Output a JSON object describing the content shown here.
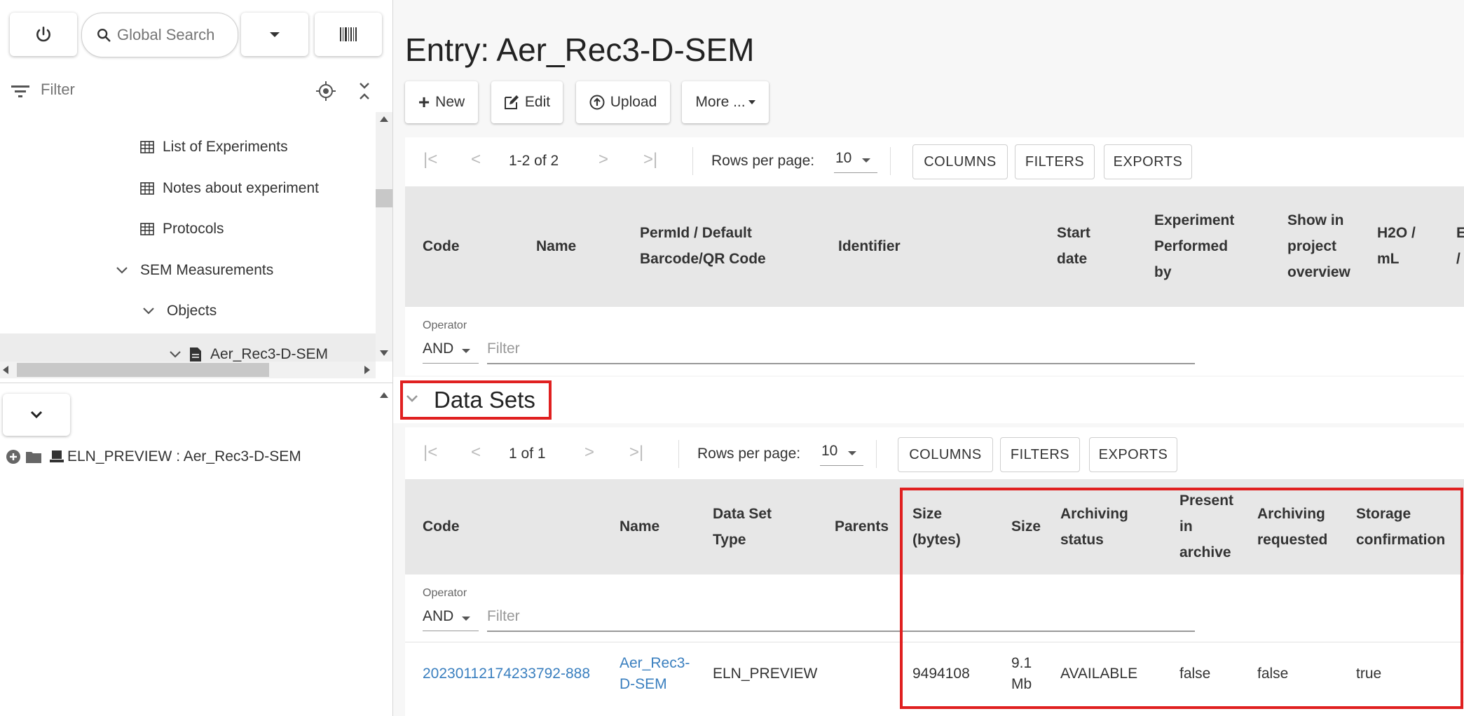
{
  "left": {
    "search_placeholder": "Global Search",
    "filter_placeholder": "Filter",
    "tree": {
      "list_of_experiments": "List of Experiments",
      "notes_about_experiment": "Notes about experiment",
      "protocols": "Protocols",
      "sem_measurements": "SEM Measurements",
      "objects": "Objects",
      "selected_entry": "Aer_Rec3-D-SEM"
    },
    "dataset_tree_item": "ELN_PREVIEW : Aer_Rec3-D-SEM"
  },
  "main": {
    "title": "Entry: Aer_Rec3-D-SEM",
    "toolbar": {
      "new_label": "New",
      "edit_label": "Edit",
      "upload_label": "Upload",
      "more_label": "More ..."
    },
    "children_table": {
      "pagination": "1-2 of 2",
      "rows_per_page_label": "Rows per page:",
      "rows_per_page_value": "10",
      "columns_label": "COLUMNS",
      "filters_label": "FILTERS",
      "exports_label": "EXPORTS",
      "headers": {
        "code": "Code",
        "name": "Name",
        "permid": "PermId / Default Barcode/QR Code",
        "identifier": "Identifier",
        "start_date": "Start date",
        "performed_by": "Experiment Performed by",
        "show_overview": "Show in project overview",
        "h2o": "H2O / mL",
        "extra": "E /"
      },
      "operator_label": "Operator",
      "operator_value": "AND",
      "filter_placeholder": "Filter"
    },
    "datasets": {
      "section_title": "Data Sets",
      "pagination": "1 of 1",
      "rows_per_page_label": "Rows per page:",
      "rows_per_page_value": "10",
      "columns_label": "COLUMNS",
      "filters_label": "FILTERS",
      "exports_label": "EXPORTS",
      "headers": {
        "code": "Code",
        "name": "Name",
        "type": "Data Set Type",
        "parents": "Parents",
        "size_bytes": "Size (bytes)",
        "size": "Size",
        "archiving_status": "Archiving status",
        "present_in_archive": "Present in archive",
        "archiving_requested": "Archiving requested",
        "storage_confirmation": "Storage confirmation"
      },
      "operator_label": "Operator",
      "operator_value": "AND",
      "filter_placeholder": "Filter",
      "rows": [
        {
          "code": "20230112174233792-888",
          "name": "Aer_Rec3-D-SEM",
          "type": "ELN_PREVIEW",
          "parents": "",
          "size_bytes": "9494108",
          "size": "9.1 Mb",
          "archiving_status": "AVAILABLE",
          "present_in_archive": "false",
          "archiving_requested": "false",
          "storage_confirmation": "true"
        }
      ]
    }
  },
  "colors": {
    "highlight": "#e02020",
    "link": "#3a7fbf",
    "header_bg": "#e7e7e7"
  }
}
